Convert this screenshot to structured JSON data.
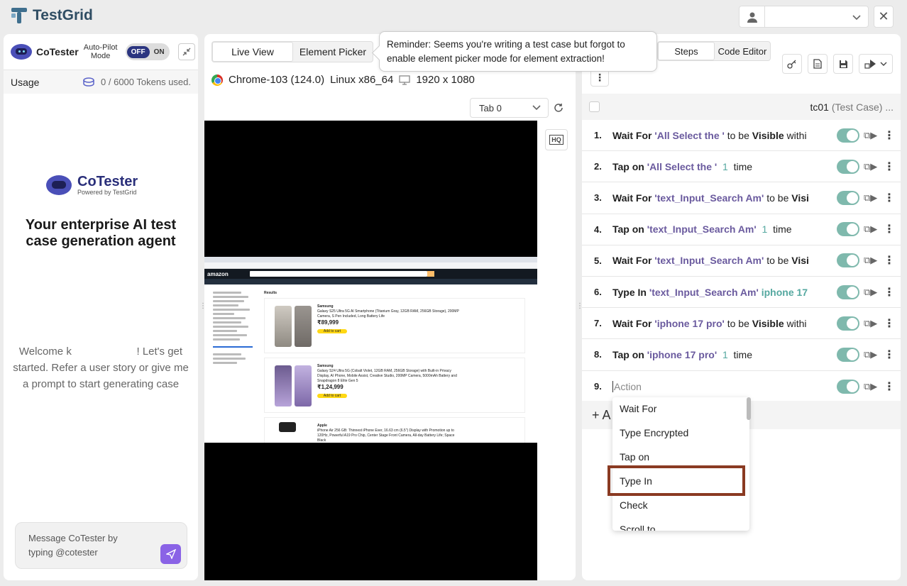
{
  "app": {
    "title": "TestGrid"
  },
  "header": {
    "user_value": "",
    "close_label": "✕"
  },
  "left": {
    "name": "CoTester",
    "autopilot_label": "Auto-Pilot Mode",
    "toggle_off": "OFF",
    "toggle_on": "ON",
    "usage_label": "Usage",
    "tokens": "0 / 6000 Tokens used.",
    "brand_name": "CoTester",
    "brand_sub": "Powered by TestGrid",
    "tagline": "Your enterprise AI test case generation agent",
    "welcome": "Welcome k                      ! Let's get started. Refer a user story or give me a prompt to start generating case",
    "message_placeholder": "Message CoTester by typing @cotester"
  },
  "middle": {
    "tabs": [
      "Live View",
      "Element Picker"
    ],
    "active_tab": "Live View",
    "browser": "Chrome-103 (124.0)",
    "os": "Linux x86_64",
    "resolution": "1920 x 1080",
    "tab_select": "Tab 0",
    "hq_label": "HQ",
    "amazon": {
      "logo": "amazon",
      "results": "Results",
      "items": [
        {
          "brand": "Samsung",
          "title": "Galaxy S25 Ultra 5G AI Smartphone (Titanium Gray, 12GB RAM, 256GB Storage), 200MP Camera, S Pen Included, Long Battery Life",
          "price": "₹89,999",
          "cta": "Add to cart"
        },
        {
          "brand": "Samsung",
          "title": "Galaxy S24 Ultra 5G (Cobalt Violet, 12GB RAM, 256GB Storage) with Built-in Privacy Display, AI Phone, Mobile Assist, Creative Studio, 200MP Camera, 5000mAh Battery and Snapdragon 8 Elite Gen 5",
          "price": "₹1,24,999",
          "cta": "Add to cart"
        },
        {
          "brand": "Apple",
          "title": "iPhone Air 256 GB: Thinnest iPhone Ever, 16.63 cm (6.5\") Display with Promotion up to 120Hz, Powerful A19 Pro Chip, Center Stage Front Camera, All-day Battery Life; Space Black",
          "price": "",
          "cta": ""
        }
      ]
    }
  },
  "tooltip": "Reminder: Seems you're writing a test case but forgot to enable element picker mode for element extraction!",
  "right": {
    "tabs": [
      "Steps",
      "Code Editor"
    ],
    "active_tab": "Steps",
    "testcase_name": "tc01",
    "testcase_type": "(Test Case) ...",
    "steps": [
      {
        "num": "1.",
        "keyword": "Wait For",
        "target": "'All Select the '",
        "rest": "to be",
        "bold": "Visible",
        "tail": "withi"
      },
      {
        "num": "2.",
        "keyword": "Tap on",
        "target": "'All Select the '",
        "count": "1",
        "tail": "time"
      },
      {
        "num": "3.",
        "keyword": "Wait For",
        "target": "'text_Input_Search Am'",
        "rest": "to be",
        "bold": "Visi",
        "tail": ""
      },
      {
        "num": "4.",
        "keyword": "Tap on",
        "target": "'text_Input_Search Am'",
        "count": "1",
        "tail": "time"
      },
      {
        "num": "5.",
        "keyword": "Wait For",
        "target": "'text_Input_Search Am'",
        "rest": "to be",
        "bold": "Visi",
        "tail": ""
      },
      {
        "num": "6.",
        "keyword": "Type In",
        "target": "'text_Input_Search Am'",
        "value": "iphone 17"
      },
      {
        "num": "7.",
        "keyword": "Wait For",
        "target": "'iphone 17 pro'",
        "rest": "to be",
        "bold": "Visible",
        "tail": "withi"
      },
      {
        "num": "8.",
        "keyword": "Tap on",
        "target": "'iphone 17 pro'",
        "count": "1",
        "tail": "time"
      },
      {
        "num": "9.",
        "placeholder": "Action"
      }
    ],
    "add_label": "+ A",
    "dropdown_options": [
      "Wait For",
      "Type Encrypted",
      "Tap on",
      "Type In",
      "Check",
      "Scroll to"
    ],
    "highlighted_option": "Type In"
  },
  "colors": {
    "accent": "#7fb9ad",
    "highlight": "#8a3a22",
    "brand": "#2f4d63"
  }
}
